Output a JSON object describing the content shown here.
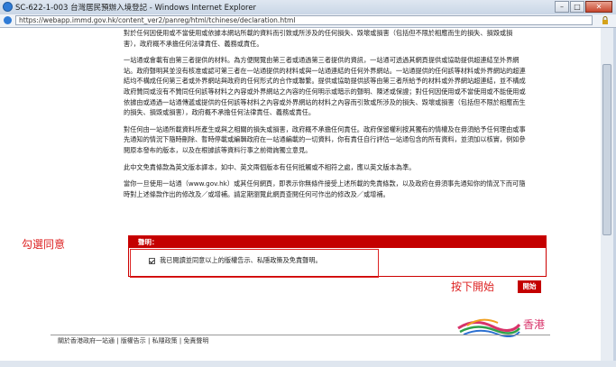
{
  "window": {
    "title": "SC-622-1-003 台灣居民預辦入境登記 - Windows Internet Explorer",
    "url": "https://webapp.immd.gov.hk/content_ver2/panreg/html/tchinese/declaration.html"
  },
  "content": {
    "paragraphs": [
      "對於任何因使用或不當使用或依據本網站所載的資料而引致或所涉及的任何損失、毀壞或損害（包括但不限於相應而生的損失、損毀或損害），政府概不承擔任何法律責任、義務或責任。",
      "一站通或會載有由第三者提供的材料。為方便閱覽由第三者或通過第三者提供的資訊，一站通可透過其網頁提供或協助提供超連結至外界網站。政府聲明其並沒有核准或認可第三者在一站通提供的材料或與一站通連結的任何外界網站。一站通提供的任何該等材料或外界網站的超連結均不構成任何第三者或外界網站與政府的任何形式的合作或聯繫。提供或協助提供該等由第三者所給予的材料或外界網站超連結，並不構成政府贊同或沒有不贊同任何該等材料之內容或外界網站之內容的任何明示或暗示的聲明、陳述或保證；對任何因使用或不當使用或不能使用或依據由或通過一站通傳遞或提供的任何該等材料之內容或外界網站的材料之內容而引致或所涉及的損失、毀壞或損害（包括但不限於相應而生的損失、損毀或損害），政府概不承擔任何法律責任、義務或責任。",
      "對任何由一站通所載資料所產生或與之相關的損失或損害，政府概不承擔任何責任。政府保留權利按其獨有的情權及在毋須給予任何理由或事先通知的情況下隨時刪除、暫時停載或編輯政府在一站通編載的一切資料，你有責任自行評估一站通包含的所有資料，並須加以核實，例如參閱原本發布的版本，以及在根據該等資料行事之前徵詢獨立意見。",
      "此中文免責條款為英文版本譯本，如中、英文兩個版本有任何抵觸或不相符之處，應以英文版本為準。",
      "當你一旦使用一站通（www.gov.hk）或其任何網頁，即表示你無條件接受上述所載的免責條款，以及政府在毋須事先通知你的情況下而可隨時對上述條款作出的修改及／或增補。請定期瀏覽此網頁查閱任何可作出的修改及／或增補。"
    ]
  },
  "declaration": {
    "header": "聲明：",
    "checkbox_label": "我已閱讀並同意以上的版權告示、私隱政策及免責聲明。",
    "checked": true
  },
  "annotations": {
    "check_agree": "勾選同意",
    "press_start": "按下開始"
  },
  "start_button": "開始",
  "logo_text": "香港",
  "footer": {
    "links": [
      "關於香港政府一站通",
      "版權告示",
      "私隱政策",
      "免責聲明"
    ]
  },
  "colors": {
    "accent": "#c40000",
    "annotation": "#dd2222"
  }
}
